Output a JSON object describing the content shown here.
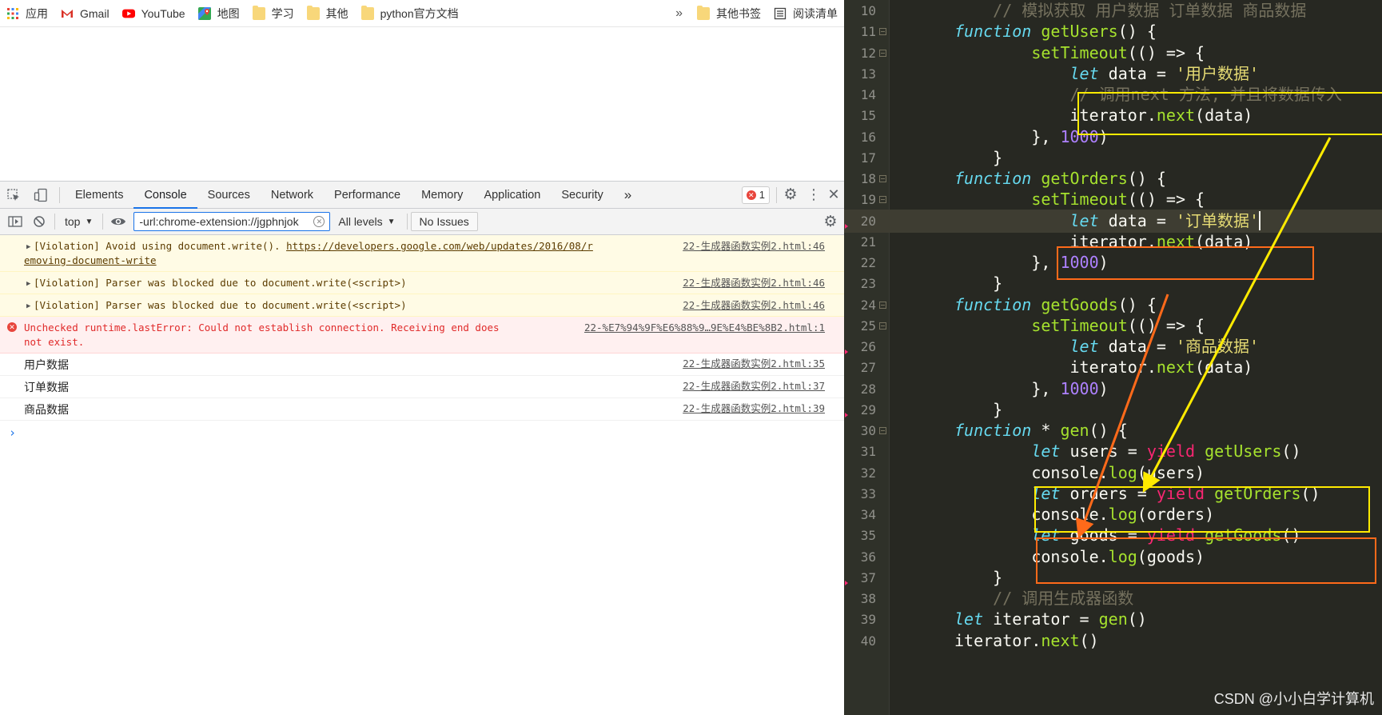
{
  "bookmarks": {
    "items": [
      {
        "label": "应用",
        "icon": "apps-grid-icon"
      },
      {
        "label": "Gmail",
        "icon": "gmail-icon"
      },
      {
        "label": "YouTube",
        "icon": "youtube-icon"
      },
      {
        "label": "地图",
        "icon": "maps-icon"
      },
      {
        "label": "学习",
        "icon": "folder-icon"
      },
      {
        "label": "其他",
        "icon": "folder-icon"
      },
      {
        "label": "python官方文档",
        "icon": "folder-icon"
      }
    ],
    "more_glyph": "»",
    "other_bookmarks": "其他书签",
    "reading_list": "阅读清单"
  },
  "devtools": {
    "tabs": [
      "Elements",
      "Console",
      "Sources",
      "Network",
      "Performance",
      "Memory",
      "Application",
      "Security"
    ],
    "active_tab": "Console",
    "more_tabs_glyph": "»",
    "error_count": "1",
    "context": "top",
    "filter_value": "-url:chrome-extension://jgphnjok",
    "levels": "All levels",
    "issues": "No Issues"
  },
  "console": {
    "messages": [
      {
        "type": "warn",
        "text": "[Violation] Avoid using document.write(). ",
        "link": "https://developers.google.com/web/updates/2016/08/r",
        "link_cont": "emoving-document-write",
        "source": "22-生成器函数实例2.html:46"
      },
      {
        "type": "warn",
        "text": "[Violation] Parser was blocked due to document.write(<script>)",
        "source": "22-生成器函数实例2.html:46"
      },
      {
        "type": "warn",
        "text": "[Violation] Parser was blocked due to document.write(<script>)",
        "source": "22-生成器函数实例2.html:46"
      },
      {
        "type": "error",
        "text": "Unchecked runtime.lastError: Could not establish connection. Receiving end does",
        "text_cont": "not exist.",
        "source": "22-%E7%94%9F%E6%88%9…9E%E4%BE%8B2.html:1"
      },
      {
        "type": "log",
        "text": "用户数据",
        "source": "22-生成器函数实例2.html:35"
      },
      {
        "type": "log",
        "text": "订单数据",
        "source": "22-生成器函数实例2.html:37"
      },
      {
        "type": "log",
        "text": "商品数据",
        "source": "22-生成器函数实例2.html:39"
      }
    ],
    "prompt_glyph": "›"
  },
  "editor": {
    "lines": [
      {
        "n": "10",
        "fold": false
      },
      {
        "n": "11",
        "fold": true
      },
      {
        "n": "12",
        "fold": true
      },
      {
        "n": "13",
        "fold": false
      },
      {
        "n": "14",
        "fold": false
      },
      {
        "n": "15",
        "fold": false
      },
      {
        "n": "16",
        "fold": false
      },
      {
        "n": "17",
        "fold": false
      },
      {
        "n": "18",
        "fold": true
      },
      {
        "n": "19",
        "fold": true
      },
      {
        "n": "20",
        "fold": false
      },
      {
        "n": "21",
        "fold": false
      },
      {
        "n": "22",
        "fold": false
      },
      {
        "n": "23",
        "fold": false
      },
      {
        "n": "24",
        "fold": true
      },
      {
        "n": "25",
        "fold": true
      },
      {
        "n": "26",
        "fold": false
      },
      {
        "n": "27",
        "fold": false
      },
      {
        "n": "28",
        "fold": false
      },
      {
        "n": "29",
        "fold": false
      },
      {
        "n": "30",
        "fold": true
      },
      {
        "n": "31",
        "fold": false
      },
      {
        "n": "32",
        "fold": false
      },
      {
        "n": "33",
        "fold": false
      },
      {
        "n": "34",
        "fold": false
      },
      {
        "n": "35",
        "fold": false
      },
      {
        "n": "36",
        "fold": false
      },
      {
        "n": "37",
        "fold": false
      },
      {
        "n": "38",
        "fold": false
      },
      {
        "n": "39",
        "fold": false
      },
      {
        "n": "40",
        "fold": false
      }
    ],
    "code": [
      [
        [
          "cm",
          "    // 模拟获取 用户数据 订单数据 商品数据"
        ]
      ],
      [
        [
          "kw",
          "function"
        ],
        [
          "",
          " "
        ],
        [
          "fn",
          "getUsers"
        ],
        [
          "",
          "() {"
        ]
      ],
      [
        [
          "",
          "        "
        ],
        [
          "fn",
          "setTimeout"
        ],
        [
          "",
          "(() => {"
        ]
      ],
      [
        [
          "",
          "            "
        ],
        [
          "kw",
          "let"
        ],
        [
          "",
          " data = "
        ],
        [
          "st",
          "'用户数据'"
        ]
      ],
      [
        [
          "",
          "            "
        ],
        [
          "cm",
          "// 调用next 方法, 并且将数据传入"
        ]
      ],
      [
        [
          "",
          "            iterator."
        ],
        [
          "fn",
          "next"
        ],
        [
          "",
          "(data)"
        ]
      ],
      [
        [
          "",
          "        }, "
        ],
        [
          "nm",
          "1000"
        ],
        [
          "",
          ")"
        ]
      ],
      [
        [
          "",
          "    }"
        ]
      ],
      [
        [
          "kw",
          "function"
        ],
        [
          "",
          " "
        ],
        [
          "fn",
          "getOrders"
        ],
        [
          "",
          "() {"
        ]
      ],
      [
        [
          "",
          "        "
        ],
        [
          "fn",
          "setTimeout"
        ],
        [
          "",
          "(() => {"
        ]
      ],
      [
        [
          "",
          "            "
        ],
        [
          "kw",
          "let"
        ],
        [
          "",
          " data = "
        ],
        [
          "st",
          "'订单数据'"
        ]
      ],
      [
        [
          "",
          "            iterator."
        ],
        [
          "fn",
          "next"
        ],
        [
          "",
          "(data)"
        ]
      ],
      [
        [
          "",
          "        }, "
        ],
        [
          "nm",
          "1000"
        ],
        [
          "",
          ")"
        ]
      ],
      [
        [
          "",
          "    }"
        ]
      ],
      [
        [
          "kw",
          "function"
        ],
        [
          "",
          " "
        ],
        [
          "fn",
          "getGoods"
        ],
        [
          "",
          "() {"
        ]
      ],
      [
        [
          "",
          "        "
        ],
        [
          "fn",
          "setTimeout"
        ],
        [
          "",
          "(() => {"
        ]
      ],
      [
        [
          "",
          "            "
        ],
        [
          "kw",
          "let"
        ],
        [
          "",
          " data = "
        ],
        [
          "st",
          "'商品数据'"
        ]
      ],
      [
        [
          "",
          "            iterator."
        ],
        [
          "fn",
          "next"
        ],
        [
          "",
          "(data)"
        ]
      ],
      [
        [
          "",
          "        }, "
        ],
        [
          "nm",
          "1000"
        ],
        [
          "",
          ")"
        ]
      ],
      [
        [
          "",
          "    }"
        ]
      ],
      [
        [
          "kw",
          "function"
        ],
        [
          "",
          " * "
        ],
        [
          "fn",
          "gen"
        ],
        [
          "",
          "() {"
        ]
      ],
      [
        [
          "",
          "        "
        ],
        [
          "kw",
          "let"
        ],
        [
          "",
          " users = "
        ],
        [
          "yd",
          "yield"
        ],
        [
          "",
          " "
        ],
        [
          "fn",
          "getUsers"
        ],
        [
          "",
          "()"
        ]
      ],
      [
        [
          "",
          "        console."
        ],
        [
          "fn",
          "log"
        ],
        [
          "",
          "(users)"
        ]
      ],
      [
        [
          "",
          "        "
        ],
        [
          "kw",
          "let"
        ],
        [
          "",
          " orders = "
        ],
        [
          "yd",
          "yield"
        ],
        [
          "",
          " "
        ],
        [
          "fn",
          "getOrders"
        ],
        [
          "",
          "()"
        ]
      ],
      [
        [
          "",
          "        console."
        ],
        [
          "fn",
          "log"
        ],
        [
          "",
          "(orders)"
        ]
      ],
      [
        [
          "",
          "        "
        ],
        [
          "kw",
          "let"
        ],
        [
          "",
          " goods = "
        ],
        [
          "yd",
          "yield"
        ],
        [
          "",
          " "
        ],
        [
          "fn",
          "getGoods"
        ],
        [
          "",
          "()"
        ]
      ],
      [
        [
          "",
          "        console."
        ],
        [
          "fn",
          "log"
        ],
        [
          "",
          "(goods)"
        ]
      ],
      [
        [
          "",
          "    }"
        ]
      ],
      [
        [
          "cm",
          "    // 调用生成器函数"
        ]
      ],
      [
        [
          "kw",
          "let"
        ],
        [
          "",
          " iterator = "
        ],
        [
          "fn",
          "gen"
        ],
        [
          "",
          "()"
        ]
      ],
      [
        [
          "",
          "iterator."
        ],
        [
          "fn",
          "next"
        ],
        [
          "",
          "()"
        ]
      ]
    ],
    "current_line": "20",
    "watermark": "CSDN @小小白学计算机",
    "annotation_colors": {
      "yellow": "#ffeb00",
      "orange": "#ff6a1a"
    }
  }
}
